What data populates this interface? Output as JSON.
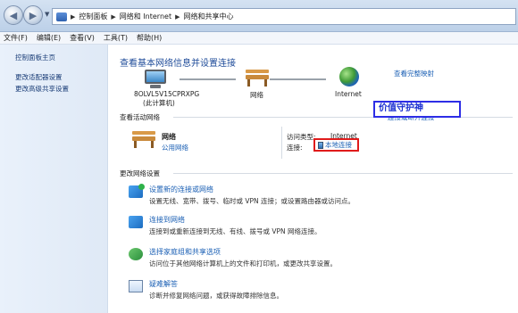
{
  "address_bar": {
    "crumbs": [
      "控制面板",
      "网络和 Internet",
      "网络和共享中心"
    ]
  },
  "menu": [
    "文件(F)",
    "编辑(E)",
    "查看(V)",
    "工具(T)",
    "帮助(H)"
  ],
  "sidebar": {
    "items": [
      {
        "label": "控制面板主页"
      },
      {
        "label": "更改适配器设置"
      },
      {
        "label": "更改高级共享设置"
      }
    ]
  },
  "main": {
    "title": "查看基本网络信息并设置连接",
    "full_map": "查看完整映射",
    "map": {
      "computer_name": "8OLVL5V15CPRXPG",
      "computer_sub": "(此计算机)",
      "network_label": "网络",
      "internet_label": "Internet"
    },
    "active_section": "查看活动网络",
    "network": {
      "name": "网络",
      "type": "公用网络",
      "access_label": "访问类型:",
      "access_value": "Internet",
      "connections_label": "连接:",
      "connection_value": "本地连接",
      "overlay_link": "连接或断开连接"
    },
    "watermark": "价值守护神",
    "change_section": "更改网络设置",
    "tasks": [
      {
        "title": "设置新的连接或网络",
        "desc": "设置无线、宽带、拨号、临时或 VPN 连接；或设置路由器或访问点。",
        "icon": "network-setup-icon"
      },
      {
        "title": "连接到网络",
        "desc": "连接到或重新连接到无线、有线、拨号或 VPN 网络连接。",
        "icon": "connect-network-icon"
      },
      {
        "title": "选择家庭组和共享选项",
        "desc": "访问位于其他网络计算机上的文件和打印机，或更改共享设置。",
        "icon": "homegroup-icon"
      },
      {
        "title": "疑难解答",
        "desc": "诊断并修复网络问题，或获得故障排除信息。",
        "icon": "troubleshoot-icon"
      }
    ]
  }
}
